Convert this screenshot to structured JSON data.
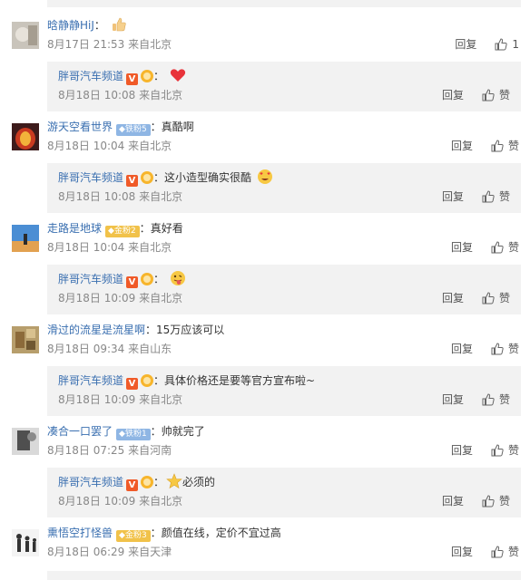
{
  "colors": {
    "username": "#3a6fb0",
    "meta": "#888888",
    "reply_bg": "#f2f2f2",
    "v_badge": "#f05a28"
  },
  "actions": {
    "reply_label": "回复",
    "like_label": "赞"
  },
  "comments": [
    {
      "username": "晗静静HiJ",
      "colon": "：",
      "text": "",
      "emoji": "thumbs-up-emoji",
      "date": "8月17日 21:53",
      "source": "来自北京",
      "likes": "1",
      "reply": {
        "username": "胖哥汽车频道",
        "badges": [
          "v-verified",
          "crown"
        ],
        "colon": "：",
        "text": "",
        "emoji": "red-heart-emoji",
        "date": "8月18日 10:08",
        "source": "来自北京"
      }
    },
    {
      "username": "游天空看世界",
      "fan_badge": "铁粉5",
      "colon": "：",
      "text": "真酷啊",
      "date": "8月18日 10:04",
      "source": "来自北京",
      "likes": "",
      "reply": {
        "username": "胖哥汽车频道",
        "badges": [
          "v-verified",
          "crown"
        ],
        "colon": "：",
        "text": "这小造型确实很酷",
        "emoji": "heart-eyes-emoji",
        "date": "8月18日 10:08",
        "source": "来自北京"
      }
    },
    {
      "username": "走路是地球",
      "fan_badge": "金粉2",
      "colon": "：",
      "text": "真好看",
      "date": "8月18日 10:04",
      "source": "来自北京",
      "likes": "",
      "reply": {
        "username": "胖哥汽车频道",
        "badges": [
          "v-verified",
          "crown"
        ],
        "colon": "：",
        "text": "",
        "emoji": "tongue-emoji",
        "date": "8月18日 10:09",
        "source": "来自北京"
      }
    },
    {
      "username": "滑过的流星是流星啊",
      "colon": "：",
      "text": "15万应该可以",
      "date": "8月18日 09:34",
      "source": "来自山东",
      "likes": "",
      "reply": {
        "username": "胖哥汽车频道",
        "badges": [
          "v-verified",
          "crown"
        ],
        "colon": "：",
        "text": "具体价格还是要等官方宣布啦~",
        "date": "8月18日 10:09",
        "source": "来自北京"
      }
    },
    {
      "username": "凑合一口罢了",
      "fan_badge": "铁粉1",
      "colon": "：",
      "text": "帅就完了",
      "date": "8月18日 07:25",
      "source": "来自河南",
      "likes": "",
      "reply": {
        "username": "胖哥汽车频道",
        "badges": [
          "v-verified",
          "crown"
        ],
        "colon": "：",
        "text": "必须的",
        "emoji_before": "star-emoji",
        "date": "8月18日 10:09",
        "source": "来自北京"
      }
    },
    {
      "username": "熏悟空打怪兽",
      "fan_badge": "金粉3",
      "colon": "：",
      "text": "颜值在线，定价不宜过高",
      "date": "8月18日 06:29",
      "source": "来自天津",
      "likes": ""
    }
  ]
}
